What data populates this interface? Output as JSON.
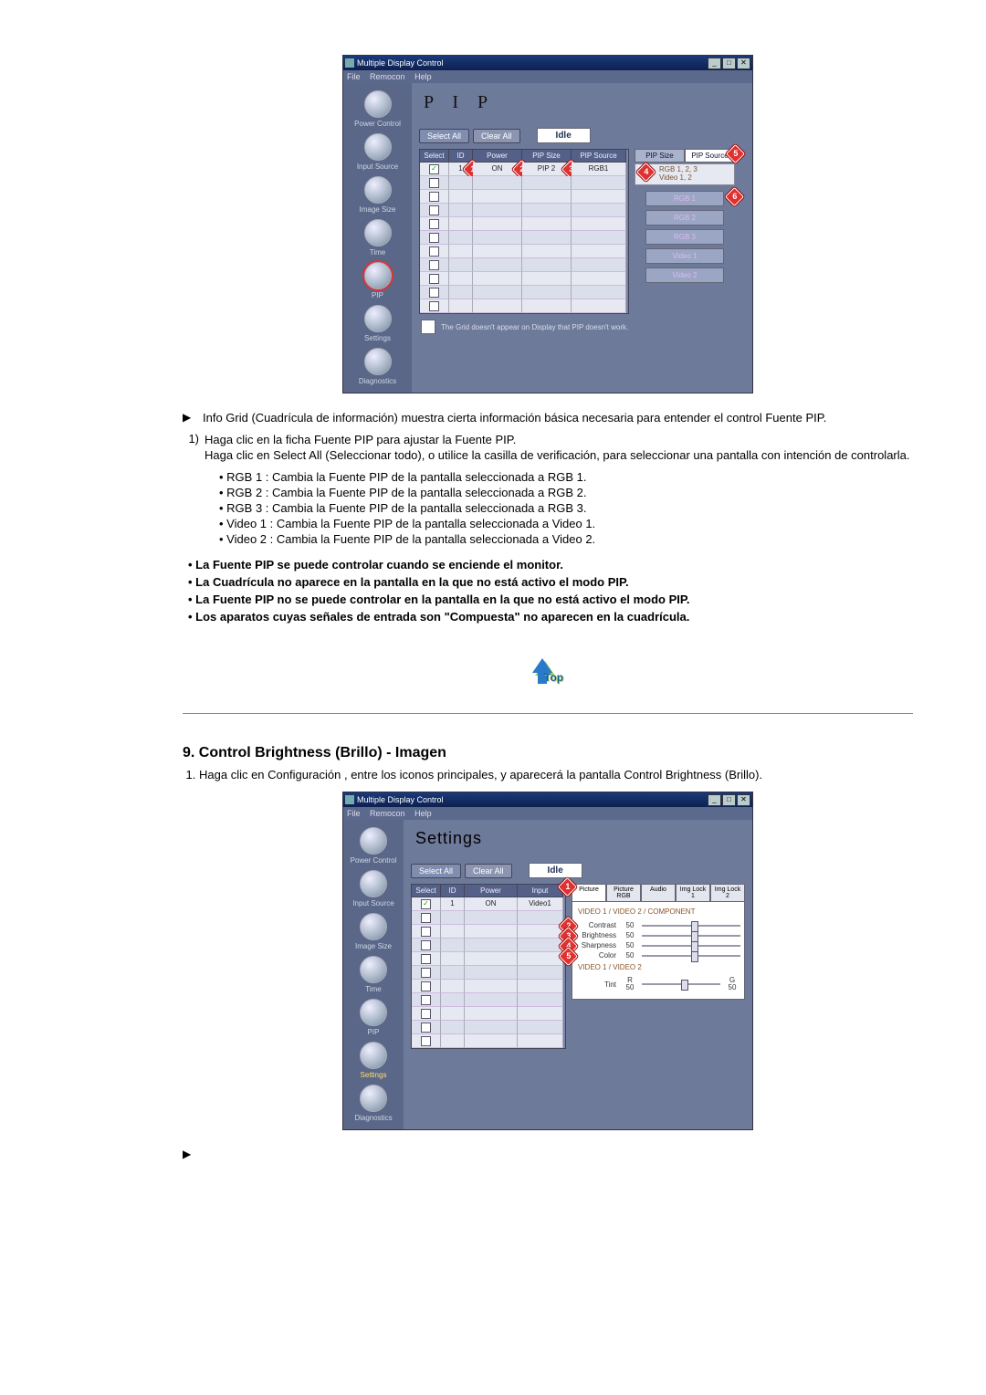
{
  "app": {
    "title": "Multiple Display Control",
    "menu": {
      "file": "File",
      "remocon": "Remocon",
      "help": "Help"
    },
    "win_buttons": {
      "min": "_",
      "max": "□",
      "close": "✕"
    },
    "sidebar": {
      "power": "Power Control",
      "input": "Input Source",
      "imagesize": "Image Size",
      "time": "Time",
      "pip": "PIP",
      "settings": "Settings",
      "diagnostics": "Diagnostics"
    },
    "buttons": {
      "select_all": "Select All",
      "clear_all": "Clear All",
      "idle": "Idle"
    },
    "pip_panel": {
      "title": "P I P",
      "head": {
        "select": "Select",
        "id": "ID",
        "power": "Power",
        "pipsize": "PIP Size",
        "pipsource": "PIP Source"
      },
      "row1": {
        "id": "1",
        "power": "ON",
        "pipsize": "PIP 2",
        "pipsource": "RGB1"
      },
      "right": {
        "tab_size": "PIP Size",
        "tab_source": "PIP Source",
        "hint": "RGB 1, 2, 3\nVideo 1, 2",
        "btns": {
          "rgb1": "RGB 1",
          "rgb2": "RGB 2",
          "rgb3": "RGB 3",
          "v1": "Video 1",
          "v2": "Video 2"
        }
      },
      "footnote": "The Grid doesn't appear on Display that PIP doesn't work."
    },
    "settings_panel": {
      "title": "Settings",
      "head": {
        "select": "Select",
        "id": "ID",
        "power": "Power",
        "input": "Input"
      },
      "row1": {
        "id": "1",
        "power": "ON",
        "input": "Video1"
      },
      "tabs": {
        "picture": "Picture",
        "picrgb": "Picture RGB",
        "audio": "Audio",
        "il1": "Img Lock 1",
        "il2": "Img Lock 2"
      },
      "group1": "VIDEO 1 / VIDEO 2 / COMPONENT",
      "sliders": {
        "contrast": {
          "label": "Contrast",
          "val": "50"
        },
        "brightness": {
          "label": "Brightness",
          "val": "50"
        },
        "sharpness": {
          "label": "Sharpness",
          "val": "50"
        },
        "color": {
          "label": "Color",
          "val": "50"
        }
      },
      "group2": "VIDEO 1 / VIDEO 2",
      "tint": {
        "label": "Tint",
        "r": "R\n50",
        "g": "G\n50"
      }
    }
  },
  "doc": {
    "p1": "Info Grid (Cuadrícula de información) muestra cierta información básica necesaria para entender el control Fuente PIP.",
    "n1_a": "Haga clic en la ficha Fuente PIP para ajustar la Fuente PIP.",
    "n1_b": "Haga clic en Select All (Seleccionar todo), o utilice la casilla de verificación, para seleccionar una pantalla con intención de controlarla.",
    "dots": {
      "d1": "• RGB 1 : Cambia la Fuente PIP de la pantalla seleccionada a RGB 1.",
      "d2": "• RGB 2 : Cambia la Fuente PIP de la pantalla seleccionada a RGB 2.",
      "d3": "• RGB 3 : Cambia la Fuente PIP de la pantalla seleccionada a RGB 3.",
      "d4": "• Video 1 : Cambia la Fuente PIP de la pantalla seleccionada a Video 1.",
      "d5": "• Video 2 : Cambia la Fuente PIP de la pantalla seleccionada a Video 2."
    },
    "bolds": {
      "b1": "La Fuente PIP se puede controlar cuando se enciende el monitor.",
      "b2": "La Cuadrícula no aparece en la pantalla en la que no está activo el modo PIP.",
      "b3": "La Fuente PIP no se puede controlar en la pantalla en la que no está activo el modo PIP.",
      "b4": "Los aparatos cuyas señales de entrada son \"Compuesta\" no aparecen en la cuadrícula."
    },
    "top_label": "Top",
    "section9": "9. Control Brightness (Brillo) - Imagen",
    "section9_p": "Haga clic en Configuración , entre los iconos principales, y aparecerá la pantalla Control Brightness (Brillo)."
  },
  "markers": {
    "m1": "1",
    "m2": "2",
    "m3": "3",
    "m4": "4",
    "m5": "5",
    "m6": "6"
  }
}
